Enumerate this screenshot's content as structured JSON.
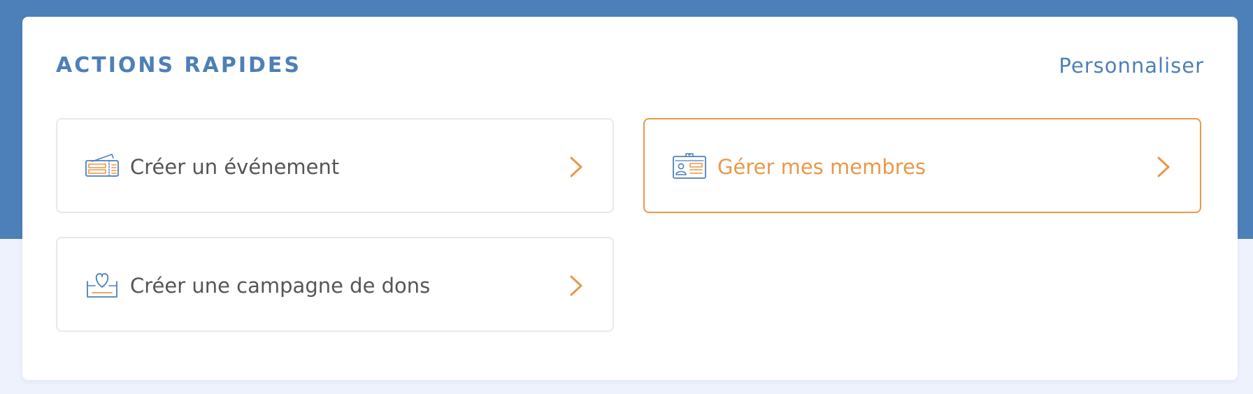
{
  "header": {
    "title": "ACTIONS RAPIDES",
    "customize_label": "Personnaliser"
  },
  "actions": [
    {
      "label": "Créer un événement",
      "icon": "ticket-icon"
    },
    {
      "label": "Gérer mes membres",
      "icon": "member-badge-icon",
      "highlighted": true
    },
    {
      "label": "Créer une campagne de dons",
      "icon": "heart-donation-box-icon"
    }
  ],
  "colors": {
    "brand_blue": "#4d7fb8",
    "accent_orange": "#e8994a",
    "text_gray": "#555555",
    "border_gray": "#e8e8ee",
    "page_background": "#eef2fc"
  }
}
